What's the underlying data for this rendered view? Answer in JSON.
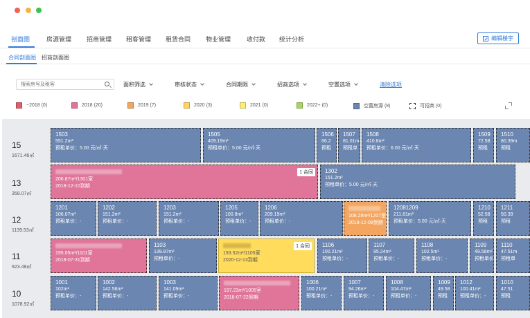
{
  "nav": {
    "items": [
      "剖面图",
      "房源管理",
      "招商管理",
      "租客管理",
      "租赁合同",
      "物业管理",
      "收付款",
      "统计分析"
    ],
    "edit_button": "编辑楼宇"
  },
  "subtabs": [
    "合同剖面图",
    "招商剖面图"
  ],
  "filters": {
    "search_placeholder": "搜索房号及租客",
    "items": [
      "面积筛选",
      "审核状态",
      "合同期限",
      "招商选项",
      "空置选项"
    ],
    "clear": "清除选项"
  },
  "legend": [
    {
      "label": "~2018 (0)",
      "color": "#e05d6b"
    },
    {
      "label": "2018 (20)",
      "color": "#e07499"
    },
    {
      "label": "2019 (7)",
      "color": "#f4a661"
    },
    {
      "label": "2020 (3)",
      "color": "#ffd65c"
    },
    {
      "label": "2021 (0)",
      "color": "#ffef6e"
    },
    {
      "label": "2022+ (0)",
      "color": "#a6d65c"
    },
    {
      "label": "空置房源 (8)",
      "color": "#6b86b0"
    },
    {
      "label": "可招商 (0)",
      "color": "#ffffff"
    }
  ],
  "floors": [
    {
      "num": "15",
      "area": "1671.46㎡",
      "rooms": [
        {
          "type": "vacant",
          "lines": [
            "1503",
            "551.2m²",
            "预租单价：5.00 元/㎡·天"
          ]
        },
        {
          "type": "vacant",
          "lines": [
            "1505",
            "409.19m²",
            "预租单价：5.00 元/㎡·天"
          ]
        },
        {
          "type": "vacant",
          "lines": [
            "1506",
            "66.2",
            "预租"
          ]
        },
        {
          "type": "vacant",
          "lines": [
            "1507",
            "81.01m",
            "预租单"
          ]
        },
        {
          "type": "vacant",
          "lines": [
            "1508",
            "410.8m²",
            "预租单价：6.00 元/㎡·天"
          ]
        },
        {
          "type": "vacant",
          "lines": [
            "1509",
            "72.58",
            "预租"
          ]
        },
        {
          "type": "vacant",
          "lines": [
            "1510",
            "80.39m",
            "预租"
          ]
        }
      ]
    },
    {
      "num": "13",
      "area": "358.07㎡",
      "rooms": [
        {
          "type": "pink",
          "badge": "1 合同",
          "lines": [
            "206.87m²/1301室",
            "2018-12-10到期"
          ]
        },
        {
          "type": "vacant",
          "lines": [
            "1302",
            "151.2m²",
            "预租单价：5.00 元/㎡·天"
          ]
        }
      ]
    },
    {
      "num": "12",
      "area": "1139.53㎡",
      "rooms": [
        {
          "type": "vacant",
          "lines": [
            "1201",
            "106.07m²",
            "预租单价：-"
          ]
        },
        {
          "type": "vacant",
          "lines": [
            "1202",
            "151.2m²",
            "预租单价：-"
          ]
        },
        {
          "type": "vacant",
          "lines": [
            "1203",
            "151.2m²",
            "预租单价：-"
          ]
        },
        {
          "type": "vacant",
          "lines": [
            "1205",
            "100.8m²",
            "预租单价：-"
          ]
        },
        {
          "type": "vacant",
          "lines": [
            "1206",
            "209.19m²",
            "预租单价：-"
          ]
        },
        {
          "type": "orange",
          "lines": [
            "106.29m²/1207室",
            "2019-12-08到期"
          ]
        },
        {
          "type": "vacant",
          "lines": [
            "12081209",
            "211.81m²",
            "预租单价：5.00 元/㎡·天"
          ]
        },
        {
          "type": "vacant",
          "lines": [
            "1210",
            "52.58",
            "预租"
          ]
        },
        {
          "type": "vacant",
          "lines": [
            "1211",
            "50.39",
            "预租"
          ]
        }
      ]
    },
    {
      "num": "11",
      "area": "923.48㎡",
      "rooms": [
        {
          "type": "pink",
          "lines": [
            "195.05m²/1101室",
            "2018-07-31到期"
          ]
        },
        {
          "type": "vacant",
          "lines": [
            "1103",
            "139.87m²",
            "预租单价：-"
          ]
        },
        {
          "type": "yellow",
          "badge": "1 合同",
          "lines": [
            "193.52m²/1105室",
            "2020-12-13到期"
          ]
        },
        {
          "type": "vacant",
          "lines": [
            "1106",
            "100.21m²",
            "预租单价：-"
          ]
        },
        {
          "type": "vacant",
          "lines": [
            "1107",
            "95.24m²",
            "预租单价：-"
          ]
        },
        {
          "type": "vacant",
          "lines": [
            "1108",
            "102.5m²",
            "预租单价：-"
          ]
        },
        {
          "type": "vacant",
          "lines": [
            "1109",
            "49.58m²",
            "预租单价"
          ]
        },
        {
          "type": "vacant",
          "lines": [
            "1110",
            "47.51m",
            "预租单"
          ]
        }
      ]
    },
    {
      "num": "10",
      "area": "1078.92㎡",
      "rooms": [
        {
          "type": "vacant",
          "lines": [
            "1001",
            "102m²",
            "预租单价：-"
          ]
        },
        {
          "type": "vacant",
          "lines": [
            "1002",
            "142.56m²",
            "预租单价：-"
          ]
        },
        {
          "type": "vacant",
          "lines": [
            "1003",
            "141.09m²",
            "预租单价：-"
          ]
        },
        {
          "type": "pink",
          "lines": [
            "197.23m²/1005室",
            "2018-07-22到期"
          ]
        },
        {
          "type": "vacant",
          "lines": [
            "1006",
            "100.21m²",
            "预租单价：-"
          ]
        },
        {
          "type": "vacant",
          "lines": [
            "1007",
            "94.26m²",
            "预租单价：-"
          ]
        },
        {
          "type": "vacant",
          "lines": [
            "1008",
            "104.47m²",
            "预租单价：-"
          ]
        },
        {
          "type": "vacant",
          "lines": [
            "1009",
            "49.58",
            "预租"
          ]
        },
        {
          "type": "vacant",
          "lines": [
            "1012",
            "100.41m²",
            "预租单价：-"
          ]
        },
        {
          "type": "vacant",
          "lines": [
            "1010",
            "47.51",
            "预租"
          ]
        }
      ]
    }
  ]
}
